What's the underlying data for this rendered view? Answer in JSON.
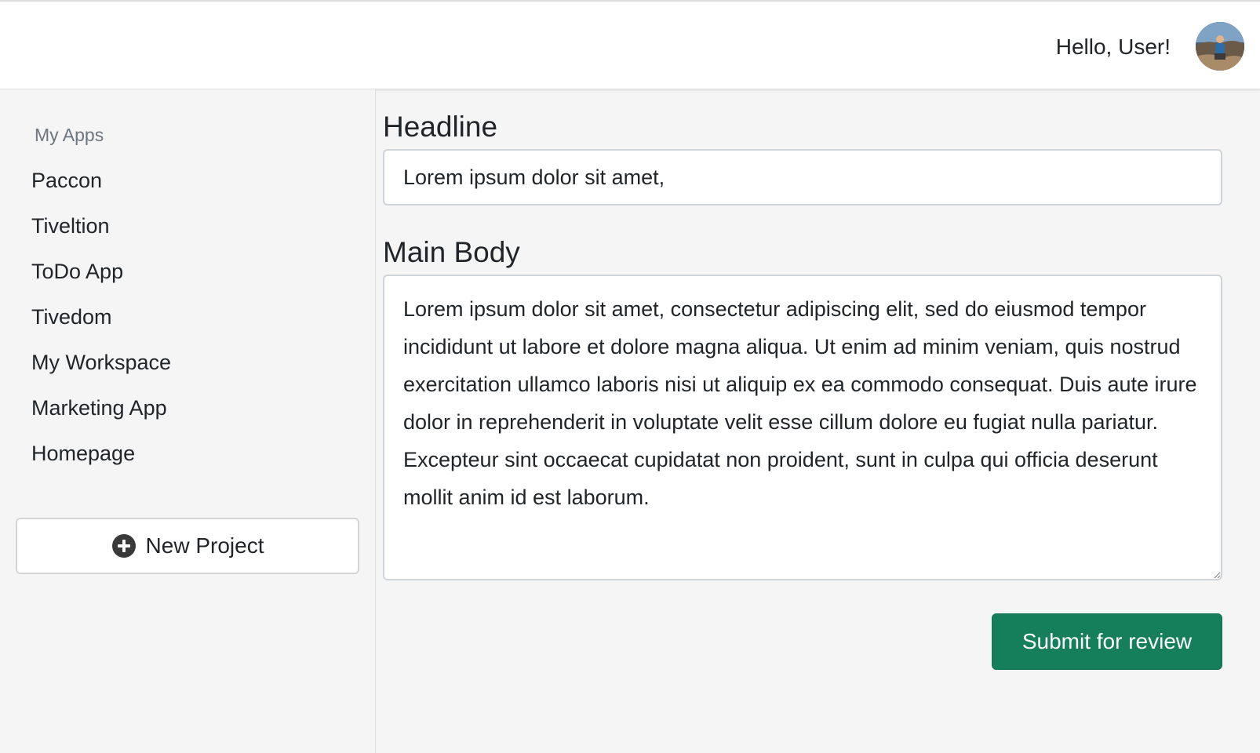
{
  "header": {
    "greeting": "Hello, User!",
    "avatar_icon": "user-avatar-photo"
  },
  "sidebar": {
    "heading": "My Apps",
    "items": [
      {
        "label": "Paccon"
      },
      {
        "label": "Tiveltion"
      },
      {
        "label": "ToDo App"
      },
      {
        "label": "Tivedom"
      },
      {
        "label": "My Workspace"
      },
      {
        "label": "Marketing App"
      },
      {
        "label": "Homepage"
      }
    ],
    "new_project_label": "New Project",
    "new_project_icon": "plus-circle-icon"
  },
  "form": {
    "headline_label": "Headline",
    "headline_value": "Lorem ipsum dolor sit amet,",
    "body_label": "Main Body",
    "body_value": "Lorem ipsum dolor sit amet, consectetur adipiscing elit, sed do eiusmod tempor incididunt ut labore et dolore magna aliqua. Ut enim ad minim veniam, quis nostrud exercitation ullamco laboris nisi ut aliquip ex ea commodo consequat. Duis aute irure dolor in reprehenderit in voluptate velit esse cillum dolore eu fugiat nulla pariatur. Excepteur sint occaecat cupidatat non proident, sunt in culpa qui officia deserunt mollit anim id est laborum.",
    "submit_label": "Submit for review"
  },
  "colors": {
    "submit_bg": "#157f5b",
    "page_bg": "#f5f5f5",
    "topbar_bg": "#ffffff"
  }
}
